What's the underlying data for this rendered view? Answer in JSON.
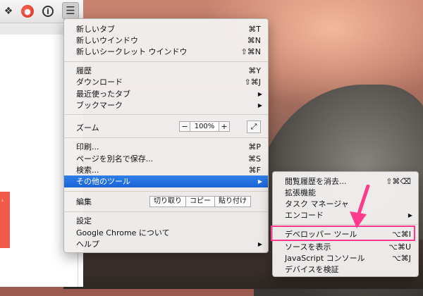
{
  "toolbar": {
    "icons": [
      "extension-icon",
      "firefox-icon",
      "info-icon",
      "menu-icon"
    ],
    "menu_glyph": "☰",
    "info_glyph": "i"
  },
  "main_menu": {
    "items": [
      {
        "label": "新しいタブ",
        "shortcut": "⌘T"
      },
      {
        "label": "新しいウインドウ",
        "shortcut": "⌘N"
      },
      {
        "label": "新しいシークレット ウインドウ",
        "shortcut": "⇧⌘N"
      },
      {
        "label": "履歴",
        "shortcut": "⌘Y"
      },
      {
        "label": "ダウンロード",
        "shortcut": "⇧⌘J"
      },
      {
        "label": "最近使ったタブ",
        "arrow": "▶"
      },
      {
        "label": "ブックマーク",
        "arrow": "▶"
      },
      {
        "label": "ズーム"
      },
      {
        "label": "印刷...",
        "shortcut": "⌘P"
      },
      {
        "label": "ページを別名で保存...",
        "shortcut": "⌘S"
      },
      {
        "label": "検索...",
        "shortcut": "⌘F"
      },
      {
        "label": "その他のツール",
        "arrow": "▶"
      },
      {
        "label": "編集"
      },
      {
        "label": "設定"
      },
      {
        "label": "Google Chrome について"
      },
      {
        "label": "ヘルプ",
        "arrow": "▶"
      }
    ],
    "zoom": {
      "minus": "−",
      "value": "100%",
      "plus": "+",
      "fullscreen": "⤢"
    },
    "edit": {
      "cut": "切り取り",
      "copy": "コピー",
      "paste": "貼り付け"
    }
  },
  "sub_menu": {
    "items": [
      {
        "label": "閲覧履歴を消去...",
        "shortcut": "⇧⌘⌫"
      },
      {
        "label": "拡張機能"
      },
      {
        "label": "タスク マネージャ"
      },
      {
        "label": "エンコード",
        "arrow": "▶"
      },
      {
        "label": "デベロッパー ツール",
        "shortcut": "⌥⌘I"
      },
      {
        "label": "ソースを表示",
        "shortcut": "⌥⌘U"
      },
      {
        "label": "JavaScript コンソール",
        "shortcut": "⌥⌘J"
      },
      {
        "label": "デバイスを検証"
      }
    ]
  },
  "colors": {
    "highlight": "#1a64d6",
    "annotation": "#ff3a8c"
  }
}
